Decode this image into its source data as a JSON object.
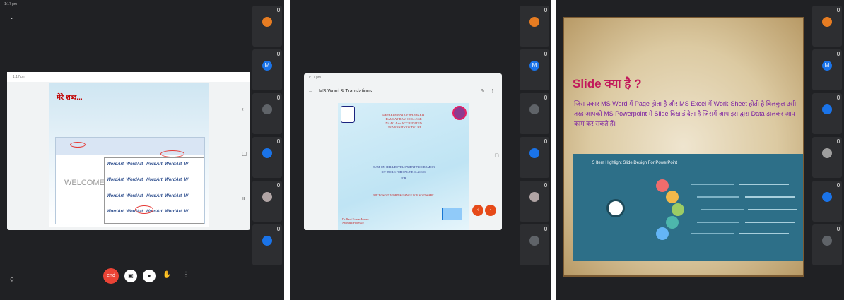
{
  "panel1": {
    "status_left": "1:17 pm",
    "status_right": "",
    "meeting_title": "",
    "tablet_time": "1:17 pm",
    "slide_title": "मेरे शब्द...",
    "slide_line": "",
    "welcome_text": "WELCOME T",
    "gallery_words": [
      "WordArt",
      "WordArt",
      "WordArt",
      "WordArt",
      "W",
      "WordArt",
      "WordArt",
      "WordArt",
      "WordArt",
      "W",
      "WordArt",
      "WordArt",
      "WordArt",
      "WordArt",
      "W",
      "WordArt",
      "WordArt",
      "WordArt",
      "WordArt",
      "W"
    ],
    "presenter_text": "",
    "end_call_label": "end",
    "participants": [
      {
        "initial": "",
        "name": "",
        "color": "#e67c22"
      },
      {
        "initial": "M",
        "name": "",
        "color": "#1a73e8"
      },
      {
        "initial": "",
        "name": "",
        "color": "#5f6368"
      },
      {
        "initial": "",
        "name": "",
        "color": "#1a73e8"
      },
      {
        "initial": "",
        "name": "",
        "color": "#b0a4a4"
      },
      {
        "initial": "",
        "name": "",
        "color": "#1a73e8"
      }
    ]
  },
  "panel2": {
    "app_title": "MS Word & Translations",
    "edit_icon": "pencil-icon",
    "dept": "DEPARTMENT OF SANSKRIT",
    "college": "DAULAT RAM COLLEGE",
    "naac": "NAAC A++ ACCREDITED",
    "univ": "UNIVERSITY OF DELHI",
    "program_a": "DUBE ON SKILL DEVELOPMENT PROGRAM ON",
    "program_b": "ICT TOOLS FOR ONLINE CLASSES",
    "program_c": "R2R",
    "subtitle": "MICROSOFT WORD & LANGUAGE SOFTWARE",
    "author_a": "Dr. Ravi Kumar Meena",
    "author_b": "Assistant Professor",
    "participants": [
      {
        "initial": "",
        "name": "",
        "color": "#e67c22"
      },
      {
        "initial": "M",
        "name": "",
        "color": "#1a73e8"
      },
      {
        "initial": "",
        "name": "",
        "color": "#5f6368"
      },
      {
        "initial": "",
        "name": "",
        "color": "#1a73e8"
      },
      {
        "initial": "",
        "name": "",
        "color": "#b0a4a4"
      },
      {
        "initial": "",
        "name": "",
        "color": "#5f6368"
      }
    ]
  },
  "panel3": {
    "slide_title": "Slide क्या है ?",
    "body": "जिस प्रकार MS Word में Page होता है और MS Excel में Work-Sheet होती है बिलकुल उसी तरह आपको MS Powerpoint में Slide दिखाई देता है जिसमें आप इस द्वारा Data डालकर आप काम कर सकते हैं।",
    "infographic_title": "5 Item Highlight Slide Design For PowerPoint",
    "participants": [
      {
        "initial": "",
        "name": "",
        "color": "#e67c22"
      },
      {
        "initial": "M",
        "name": "",
        "color": "#1a73e8"
      },
      {
        "initial": "",
        "name": "",
        "color": "#1a73e8"
      },
      {
        "initial": "",
        "name": "",
        "color": "#9e9e9e"
      },
      {
        "initial": "",
        "name": "",
        "color": "#1a73e8"
      },
      {
        "initial": "",
        "name": "",
        "color": "#5f6368"
      }
    ]
  }
}
